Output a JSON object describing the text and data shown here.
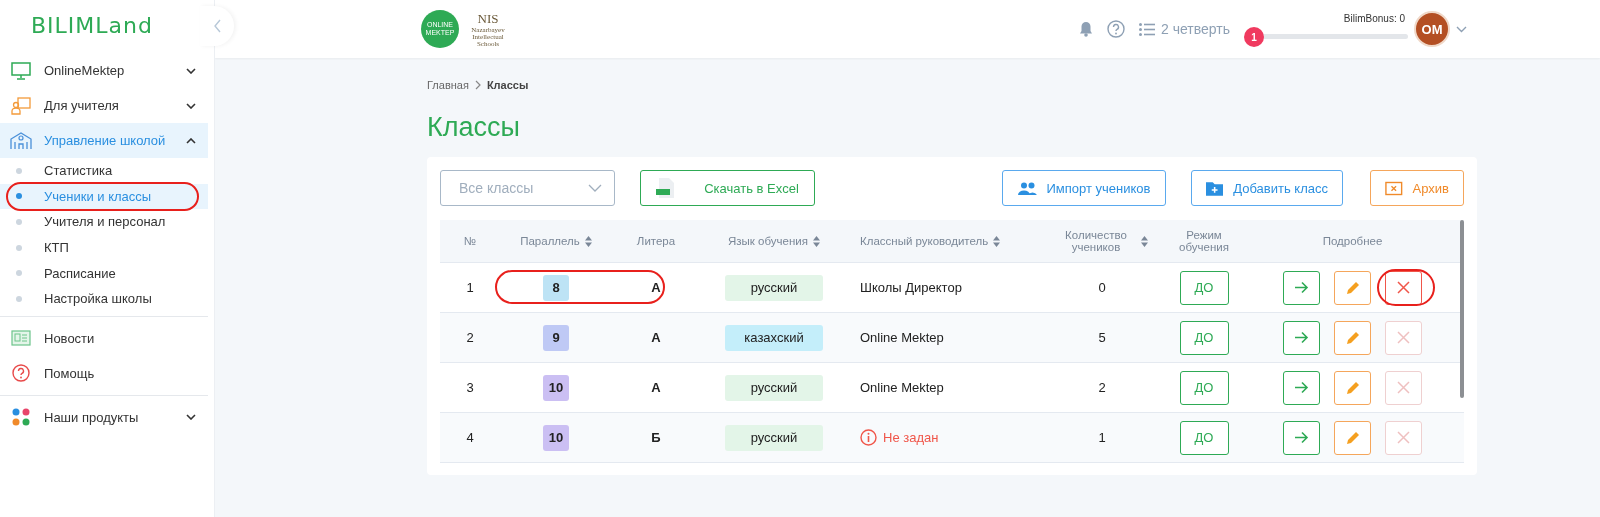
{
  "sidebar": {
    "logo": "BILIMLand",
    "groups": [
      {
        "items": [
          {
            "label": "OnlineMektep",
            "selected": false,
            "expanded": false
          },
          {
            "label": "Для учителя",
            "selected": false,
            "expanded": false
          },
          {
            "label": "Управление школой",
            "selected": true,
            "expanded": true,
            "children": [
              {
                "label": "Статистика",
                "selected": false,
                "circled": false
              },
              {
                "label": "Ученики и классы",
                "selected": true,
                "circled": true
              },
              {
                "label": "Учителя и персонал",
                "selected": false,
                "circled": false
              },
              {
                "label": "КТП",
                "selected": false,
                "circled": false
              },
              {
                "label": "Расписание",
                "selected": false,
                "circled": false
              },
              {
                "label": "Настройка школы",
                "selected": false,
                "circled": false
              }
            ]
          }
        ]
      },
      {
        "items": [
          {
            "label": "Новости",
            "selected": false
          },
          {
            "label": "Помощь",
            "selected": false
          }
        ]
      },
      {
        "items": [
          {
            "label": "Наши продукты",
            "selected": false,
            "expanded": false
          }
        ]
      }
    ]
  },
  "header": {
    "online_logo": "ONLINE MEKTEP",
    "nis_logo": "NIS",
    "nis_caption": "Nazarbayev Intellectual Schools",
    "quarter": "2 четверть",
    "level_badge": "1",
    "bonus": "BilimBonus: 0",
    "bonus_progress": {
      "level": 0
    },
    "avatar": "OM"
  },
  "breadcrumb": [
    {
      "label": "Главная",
      "current": false
    },
    {
      "label": "Классы",
      "current": true
    }
  ],
  "title": "Классы",
  "toolbar": {
    "filter": {
      "placeholder": "Все классы"
    },
    "excel": "Скачать в Excel",
    "import": "Импорт учеников",
    "add": "Добавить класс",
    "archive": "Архив"
  },
  "table": {
    "columns": [
      {
        "label": "№",
        "sortable": false
      },
      {
        "label": "Параллель",
        "sortable": true
      },
      {
        "label": "Литера",
        "sortable": false
      },
      {
        "label": "Язык обучения",
        "sortable": true
      },
      {
        "label": "Классный руководитель",
        "sortable": true
      },
      {
        "label": "Количество учеников",
        "sortable": true
      },
      {
        "label": "Режим обучения",
        "sortable": false
      },
      {
        "label": "Подробнее",
        "sortable": false
      }
    ],
    "rows": [
      {
        "number": "1",
        "grade": {
          "text": "8",
          "color": "#bde3f5"
        },
        "letter": "А",
        "language": {
          "text": "русский",
          "color": "#e3f5e8"
        },
        "teacher": "Школы Директор",
        "teacher_missing": false,
        "students": "0",
        "mode": "ДО",
        "delete_disabled": false,
        "circled": true,
        "delete_circled": true
      },
      {
        "number": "2",
        "grade": {
          "text": "9",
          "color": "#bfc9f5"
        },
        "letter": "А",
        "language": {
          "text": "казахский",
          "color": "#c4eefa"
        },
        "teacher": "Online Mektep",
        "teacher_missing": false,
        "students": "5",
        "mode": "ДО",
        "delete_disabled": true,
        "circled": false,
        "delete_circled": false
      },
      {
        "number": "3",
        "grade": {
          "text": "10",
          "color": "#cbbff3"
        },
        "letter": "А",
        "language": {
          "text": "русский",
          "color": "#e3f5e8"
        },
        "teacher": "Online Mektep",
        "teacher_missing": false,
        "students": "2",
        "mode": "ДО",
        "delete_disabled": true,
        "circled": false,
        "delete_circled": false
      },
      {
        "number": "4",
        "grade": {
          "text": "10",
          "color": "#cbbff3"
        },
        "letter": "Б",
        "language": {
          "text": "русский",
          "color": "#e3f5e8"
        },
        "teacher": "Не задан",
        "teacher_missing": true,
        "students": "1",
        "mode": "ДО",
        "delete_disabled": true,
        "circled": false,
        "delete_circled": false
      }
    ]
  }
}
